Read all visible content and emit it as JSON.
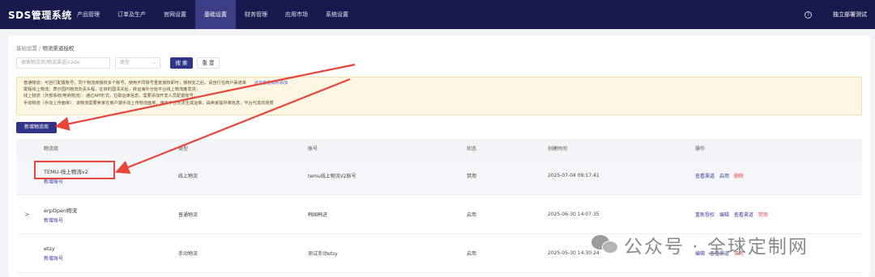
{
  "app": {
    "logo": "SDS管理系统"
  },
  "nav": {
    "items": [
      "产品管理",
      "订单及生产",
      "官网设置",
      "基础设置",
      "财务管理",
      "应用市场",
      "系统设置"
    ],
    "active_index": 3,
    "user": "独立部署测试",
    "help_icon": "?"
  },
  "breadcrumb": {
    "parent": "基础设置",
    "sep": "/",
    "current": "物流渠道授权"
  },
  "filters": {
    "search_placeholder": "搜索物流商/物流渠道/code",
    "type_placeholder": "类型",
    "search_button": "搜 索",
    "reset_button": "重 置"
  },
  "notice": {
    "lines": [
      "普通物流：可自行配置账号，同个物流商授权多个账号，使用不同账号重复授权即可；授权完之后，请自行在商户渠道单",
      "尾程线上物流：表示国内物流负责头程，在目的国清关后，转运海外仓给平台线上物流度发货；",
      "线上物流（外部系统/电商物流）：通过API形式，拉取运单信息，需要添加开发人员配置账号；",
      "手动物流（手动上传面单）：该物流需要卖家在商户端手动上传物流面单，用于平台无法生成运单，由卖家提供单信息，平台代发的场景"
    ],
    "link": "点击查看如何添加"
  },
  "add_button": "新增物流商",
  "table": {
    "headers": [
      "物流商",
      "类型",
      "账号",
      "状态",
      "创建时间",
      "操作"
    ],
    "rows": [
      {
        "expand": "",
        "name": "TEMU-线上物流v2",
        "sub": "新增账号",
        "type": "线上物流",
        "account": "temu线上物流V2账号",
        "status": "禁用",
        "created": "2025-07-04 09:17:41",
        "ops": [
          {
            "label": "查看渠道",
            "danger": false
          },
          {
            "label": "启用",
            "danger": false
          },
          {
            "label": "删除",
            "danger": true
          }
        ]
      },
      {
        "expand": ">",
        "name": "erpOpen物流",
        "sub": "新增账号",
        "type": "普通物流",
        "account": "韩国韩进",
        "status": "启用",
        "created": "2025-06-30 14:07:35",
        "ops": [
          {
            "label": "重新授权",
            "danger": false
          },
          {
            "label": "编辑",
            "danger": false
          },
          {
            "label": "查看渠道",
            "danger": false
          },
          {
            "label": "禁用",
            "danger": true
          }
        ]
      },
      {
        "expand": "",
        "name": "etsy",
        "sub": "新增账号",
        "type": "手动物流",
        "account": "测试手动etsy",
        "status": "启用",
        "created": "2025-05-30 14:30:24",
        "ops": [
          {
            "label": "编辑",
            "danger": false
          },
          {
            "label": "查看渠道",
            "danger": false
          },
          {
            "label": "禁用",
            "danger": true
          }
        ]
      }
    ]
  },
  "watermark": {
    "text": "公众号 · 全球定制网"
  },
  "colors": {
    "nav_bg": "#181a4d",
    "primary": "#2f3487",
    "annotation": "#e8463a",
    "danger": "#e04848"
  }
}
